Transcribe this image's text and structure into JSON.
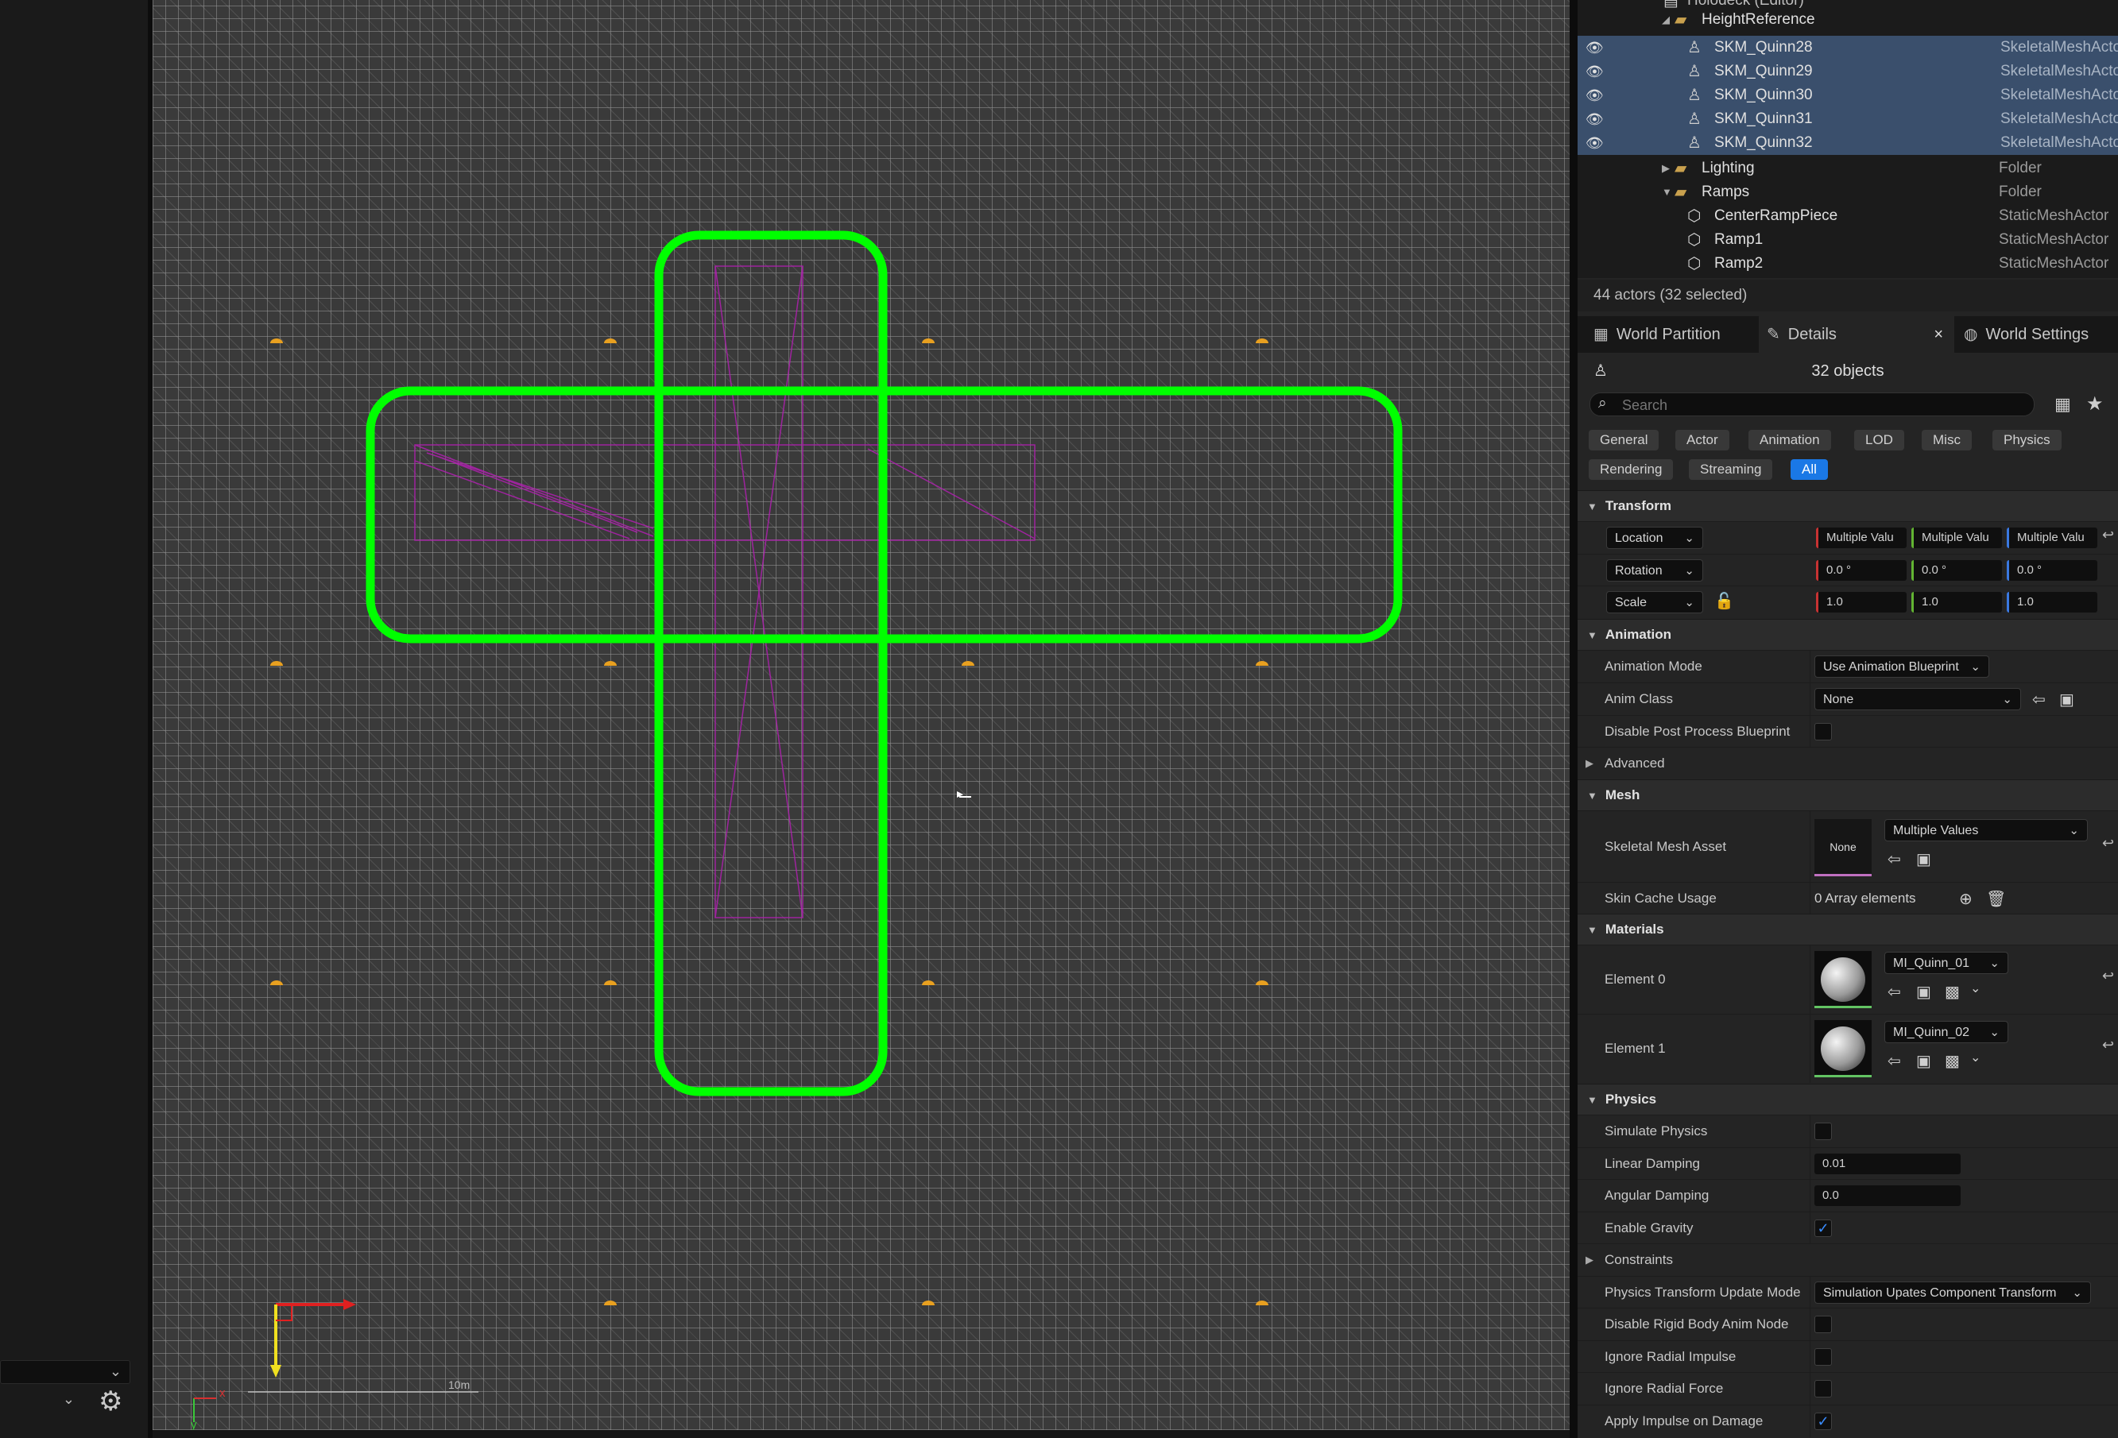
{
  "outliner": {
    "rows": [
      {
        "name": "Holodeck (Editor)",
        "type": ""
      },
      {
        "name": "HeightReference",
        "type": ""
      },
      {
        "name": "SKM_Quinn28",
        "type": "SkeletalMeshActor"
      },
      {
        "name": "SKM_Quinn29",
        "type": "SkeletalMeshActor"
      },
      {
        "name": "SKM_Quinn30",
        "type": "SkeletalMeshActor"
      },
      {
        "name": "SKM_Quinn31",
        "type": "SkeletalMeshActor"
      },
      {
        "name": "SKM_Quinn32",
        "type": "SkeletalMeshActor"
      },
      {
        "name": "Lighting",
        "type": "Folder"
      },
      {
        "name": "Ramps",
        "type": "Folder"
      },
      {
        "name": "CenterRampPiece",
        "type": "StaticMeshActor"
      },
      {
        "name": "Ramp1",
        "type": "StaticMeshActor"
      },
      {
        "name": "Ramp2",
        "type": "StaticMeshActor"
      }
    ],
    "actor_count": "44 actors (32 selected)"
  },
  "tabs": {
    "world_partition": "World Partition",
    "details": "Details",
    "world_settings": "World Settings",
    "close": "×"
  },
  "details": {
    "objects": "32 objects",
    "search_placeholder": "Search",
    "filters": [
      "General",
      "Actor",
      "Animation",
      "LOD",
      "Misc",
      "Physics",
      "Rendering",
      "Streaming",
      "All"
    ],
    "active_filter": "All"
  },
  "transform": {
    "title": "Transform",
    "location_label": "Location",
    "rotation_label": "Rotation",
    "scale_label": "Scale",
    "location": [
      "Multiple Valu",
      "Multiple Valu",
      "Multiple Valu"
    ],
    "rotation": [
      "0.0 °",
      "0.0 °",
      "0.0 °"
    ],
    "scale": [
      "1.0",
      "1.0",
      "1.0"
    ]
  },
  "animation": {
    "title": "Animation",
    "mode_label": "Animation Mode",
    "mode_value": "Use Animation Blueprint",
    "class_label": "Anim Class",
    "class_value": "None",
    "disable_pp_label": "Disable Post Process Blueprint",
    "advanced_label": "Advanced"
  },
  "mesh": {
    "title": "Mesh",
    "asset_label": "Skeletal Mesh Asset",
    "asset_thumb": "None",
    "asset_value": "Multiple Values",
    "skin_label": "Skin Cache Usage",
    "skin_value": "0 Array elements"
  },
  "materials": {
    "title": "Materials",
    "el0_label": "Element 0",
    "el0_value": "MI_Quinn_01",
    "el1_label": "Element 1",
    "el1_value": "MI_Quinn_02"
  },
  "physics": {
    "title": "Physics",
    "simulate_label": "Simulate Physics",
    "linear_label": "Linear Damping",
    "linear_value": "0.01",
    "angular_label": "Angular Damping",
    "angular_value": "0.0",
    "gravity_label": "Enable Gravity",
    "constraints_label": "Constraints",
    "update_label": "Physics Transform Update Mode",
    "update_value": "Simulation Upates Component Transform",
    "disable_rigid_label": "Disable Rigid Body Anim Node",
    "radial_impulse_label": "Ignore Radial Impulse",
    "radial_force_label": "Ignore Radial Force",
    "apply_impulse_label": "Apply Impulse on Damage"
  },
  "viewport": {
    "scale_label": "10m",
    "axis_x": "x",
    "axis_y": "y"
  },
  "colors": {
    "selection_outline": "#00ff00",
    "selected_row": "#3a4f6c",
    "active_filter": "#1a78e6",
    "folder": "#c9a14e"
  }
}
